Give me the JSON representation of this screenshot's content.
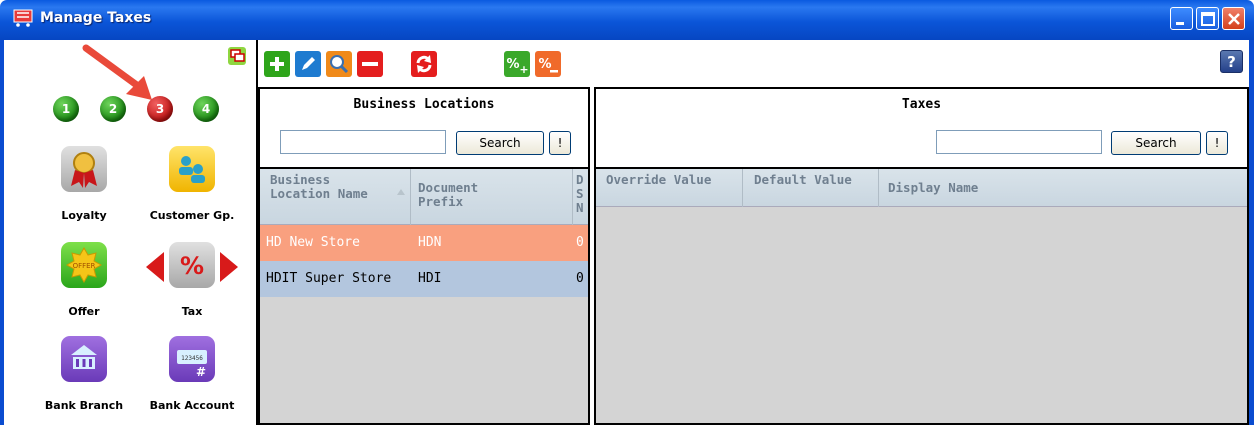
{
  "window": {
    "title": "Manage Taxes"
  },
  "left": {
    "steps": [
      {
        "label": "1",
        "color": "green"
      },
      {
        "label": "2",
        "color": "green"
      },
      {
        "label": "3",
        "color": "red"
      },
      {
        "label": "4",
        "color": "green"
      }
    ],
    "tiles": [
      {
        "label": "Loyalty"
      },
      {
        "label": "Customer Gp."
      },
      {
        "label": "Offer"
      },
      {
        "label": "Tax"
      },
      {
        "label": "Bank Branch"
      },
      {
        "label": "Bank Account"
      }
    ]
  },
  "toolbar": {
    "help_label": "?"
  },
  "locations": {
    "title": "Business Locations",
    "search_label": "Search",
    "clear_label": "!",
    "columns": [
      "Business Location Name",
      "Document Prefix",
      "D S N"
    ],
    "rows": [
      {
        "name": "HD New Store",
        "prefix": "HDN",
        "d": "0",
        "selected": true
      },
      {
        "name": "HDIT Super Store",
        "prefix": "HDI",
        "d": "0",
        "selected": false
      }
    ]
  },
  "taxes": {
    "title": "Taxes",
    "search_label": "Search",
    "clear_label": "!",
    "columns": [
      "Override Value",
      "Default Value",
      "Display Name"
    ]
  },
  "colors": {
    "titlebar": "#0a5ae0",
    "selected_row": "#f9a07f",
    "alt_row": "#b3c6de",
    "panel_bg": "#d4d4d4"
  }
}
